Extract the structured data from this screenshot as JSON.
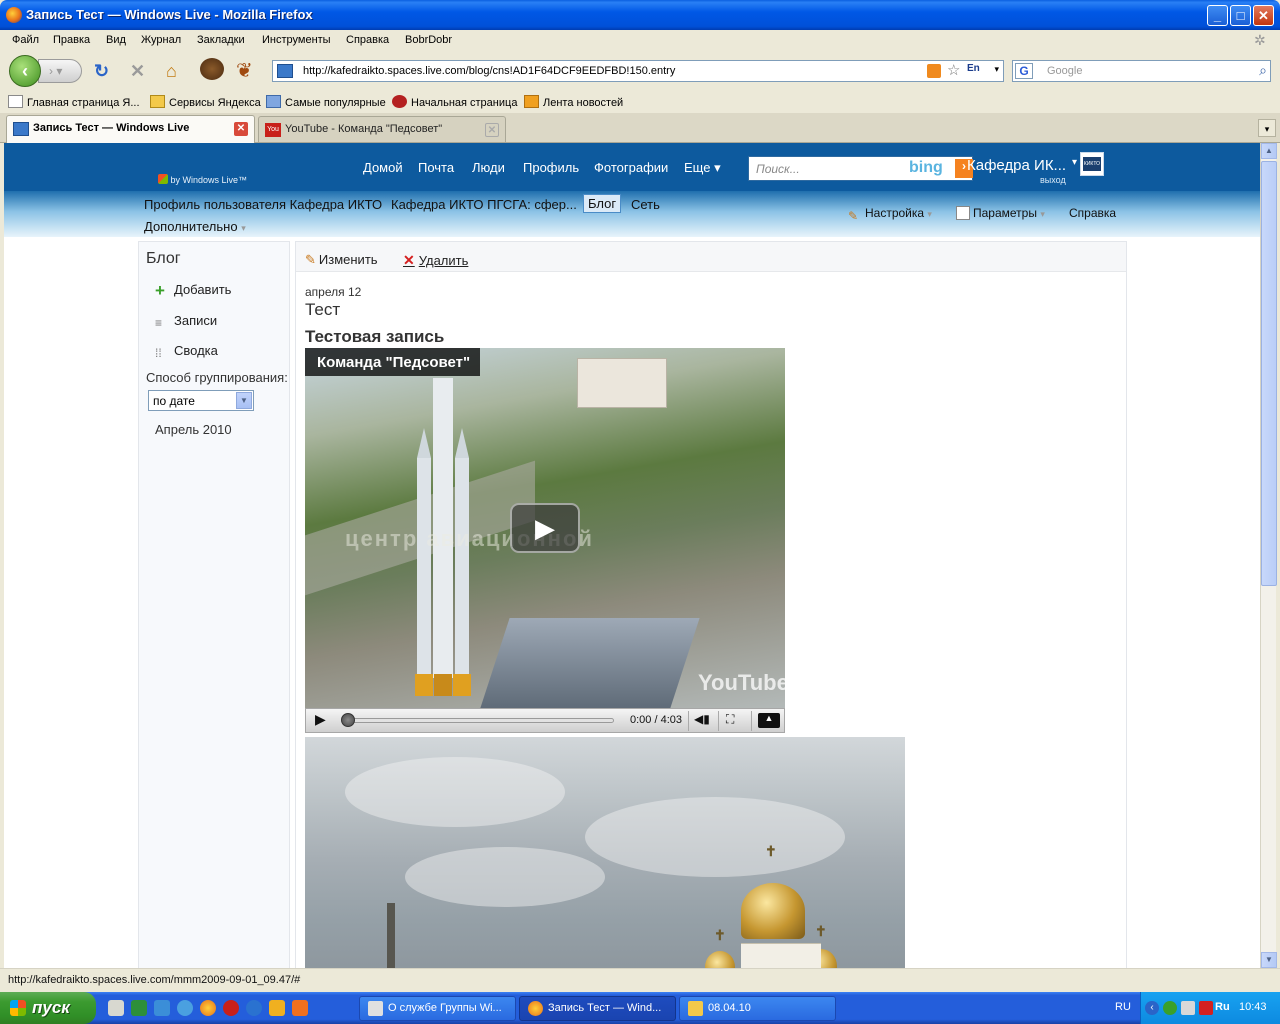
{
  "window": {
    "title": "Запись Тест — Windows Live - Mozilla Firefox"
  },
  "menu": [
    "Файл",
    "Правка",
    "Вид",
    "Журнал",
    "Закладки",
    "Инструменты",
    "Справка",
    "BobrDobr"
  ],
  "address_bar": {
    "url": "http://kafedraikto.spaces.live.com/blog/cns!AD1F64DCF9EEDFBD!150.entry",
    "lang_badge": "En"
  },
  "search_bar": {
    "engine_letter": "G",
    "placeholder": "Google"
  },
  "bookmarks": [
    "Главная страница Я...",
    "Сервисы Яндекса",
    "Самые популярные",
    "Начальная страница",
    "Лента новостей"
  ],
  "tabs": [
    {
      "label": "Запись Тест — Windows Live",
      "active": true
    },
    {
      "label": "YouTube - Команда \"Педсовет\"",
      "active": false
    }
  ],
  "site": {
    "brand": "by Windows Live™",
    "topnav": [
      "Домой",
      "Почта",
      "Люди",
      "Профиль",
      "Фотографии",
      "Еще ▾"
    ],
    "search_placeholder": "Поиск...",
    "search_logo": "bing",
    "user_name": "Кафедра ИК...",
    "signout": "выход",
    "userpic_text": "КИКТО",
    "subnav": [
      "Профиль пользователя Кафедра ИКТО",
      "Кафедра ИКТО ПГСГА: сфер...",
      "Блог",
      "Сеть"
    ],
    "subnav_selected": "Блог",
    "more": "Дополнительно",
    "rightnav": [
      "Настройка",
      "Параметры",
      "Справка"
    ]
  },
  "sidebar": {
    "title": "Блог",
    "items": [
      "Добавить",
      "Записи",
      "Сводка"
    ],
    "group_label": "Способ группирования:",
    "group_value": "по дате",
    "archive_month": "Апрель 2010"
  },
  "post": {
    "actions": {
      "edit": "Изменить",
      "delete": "Удалить"
    },
    "date": "апреля 12",
    "title": "Тест",
    "heading": "Тестовая запись",
    "video": {
      "title": "Команда \"Педсовет\"",
      "overlay_caption": "центр авиационной",
      "watermark": "YouTube",
      "time": "0:00 / 4:03",
      "progress": 0.0
    }
  },
  "status_bar": {
    "text": "http://kafedraikto.spaces.live.com/mmm2009-09-01_09.47/#"
  },
  "taskbar": {
    "start": "пуск",
    "tasks": [
      {
        "label": "О службе Группы Wi...",
        "active": false
      },
      {
        "label": "Запись Тест — Wind...",
        "active": true
      },
      {
        "label": "08.04.10",
        "active": false
      }
    ],
    "lang": "RU",
    "tray_lang": "Ru",
    "clock": "10:43"
  }
}
